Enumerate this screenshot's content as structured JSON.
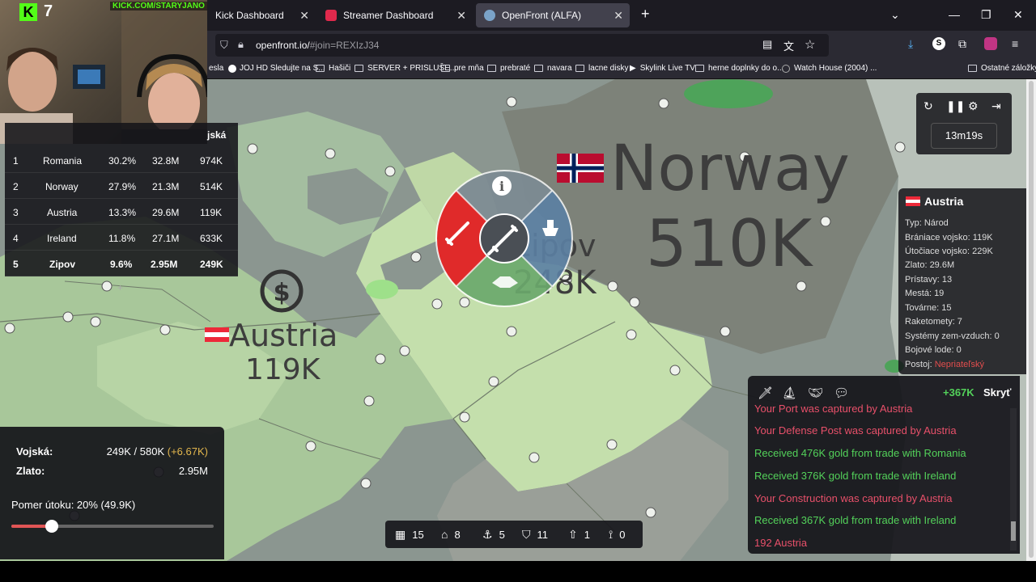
{
  "browser": {
    "tabs": [
      {
        "label": "Kick Dashboard",
        "active": false
      },
      {
        "label": "Streamer Dashboard",
        "active": false
      },
      {
        "label": "OpenFront (ALFA)",
        "active": true
      }
    ],
    "url_host": "openfront.io/",
    "url_path": "#join=REXIzJ34",
    "bookmarks": [
      "esla",
      "JOJ HD Sledujte na S...",
      "Hašiči",
      "SERVER + PRISLUŠE...",
      "pre mňa",
      "prebraté",
      "navara",
      "lacne disky",
      "Skylink Live TV",
      "herne doplnky do o...",
      "Watch House (2004) ...",
      "Ostatné záložky"
    ]
  },
  "stream": {
    "kick_logo": "K",
    "viewer_count": "7",
    "kick_url": "KICK.COM/STARYJANO"
  },
  "leaderboard": {
    "header": "jská",
    "rows": [
      {
        "rank": "1",
        "name": "Romania",
        "percent": "30.2%",
        "gold": "32.8M",
        "troops": "974K"
      },
      {
        "rank": "2",
        "name": "Norway",
        "percent": "27.9%",
        "gold": "21.3M",
        "troops": "514K"
      },
      {
        "rank": "3",
        "name": "Austria",
        "percent": "13.3%",
        "gold": "29.6M",
        "troops": "119K"
      },
      {
        "rank": "4",
        "name": "Ireland",
        "percent": "11.8%",
        "gold": "27.1M",
        "troops": "633K"
      },
      {
        "rank": "5",
        "name": "Zipov",
        "percent": "9.6%",
        "gold": "2.95M",
        "troops": "249K"
      }
    ],
    "expand_label": "+"
  },
  "map_labels": {
    "norway_name": "Norway",
    "norway_troops": "510K",
    "austria_name": "Austria",
    "austria_troops": "119K",
    "zipov_name": "Zipov",
    "zipov_troops": "248K"
  },
  "player_stats": {
    "troops_label": "Vojská:",
    "troops_value": "249K / 580K",
    "troops_gain": "(+6.67K)",
    "gold_label": "Zlato:",
    "gold_value": "2.95M",
    "attack_ratio_label": "Pomer útoku: 20% (49.9K)",
    "attack_ratio": 0.2
  },
  "controls": {
    "icons": [
      "restart-icon",
      "pause-icon",
      "settings-icon",
      "exit-icon"
    ],
    "timer": "13m19s"
  },
  "country_info": {
    "name": "Austria",
    "lines": [
      {
        "label": "Typ: Národ"
      },
      {
        "label": "Brániace vojsko: 119K"
      },
      {
        "label": "Útočiace vojsko: 229K"
      },
      {
        "label": "Zlato: 29.6M"
      },
      {
        "label": "Prístavy: 13"
      },
      {
        "label": "Mestá: 19"
      },
      {
        "label": "Továrne: 15"
      },
      {
        "label": "Raketomety: 7"
      },
      {
        "label": "Systémy zem-vzduch: 0"
      },
      {
        "label": "Bojové lode: 0"
      }
    ],
    "stance_label": "Postoj:",
    "stance_value": "Nepriateľský"
  },
  "events": {
    "gold_gain": "+367K",
    "hide_label": "Skryť",
    "messages": [
      {
        "text": "Your Port was captured by Austria",
        "kind": "red"
      },
      {
        "text": "Your Defense Post was captured by Austria",
        "kind": "red"
      },
      {
        "text": "Received 476K gold from trade with Romania",
        "kind": "green"
      },
      {
        "text": "Received 376K gold from trade with Ireland",
        "kind": "green"
      },
      {
        "text": "Your Construction was captured by Austria",
        "kind": "red"
      },
      {
        "text": "Received 367K gold from trade with Ireland",
        "kind": "green"
      },
      {
        "text": "192 Austria",
        "kind": "red"
      }
    ]
  },
  "build_bar": [
    {
      "icon": "city-icon",
      "count": "15"
    },
    {
      "icon": "factory-icon",
      "count": "8"
    },
    {
      "icon": "port-icon",
      "count": "5"
    },
    {
      "icon": "defense-post-icon",
      "count": "11"
    },
    {
      "icon": "missile-silo-icon",
      "count": "1"
    },
    {
      "icon": "sam-launcher-icon",
      "count": "0"
    }
  ],
  "colors": {
    "attack_red": "#e02a2a",
    "ally_green": "#6aa86b",
    "info_blue": "#5b7fa3",
    "kick_green": "#53fc18"
  }
}
